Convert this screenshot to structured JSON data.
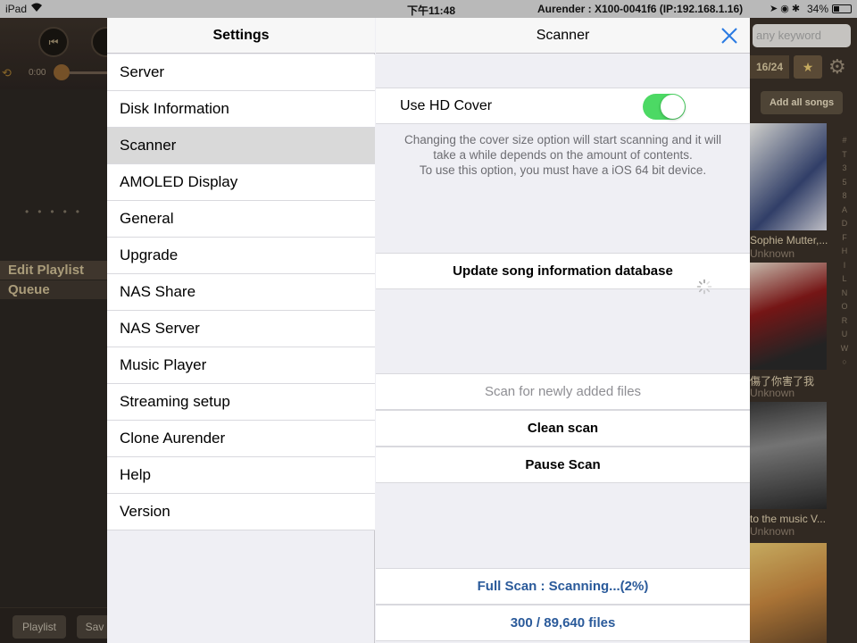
{
  "status_bar": {
    "device": "iPad",
    "time": "下午11:48",
    "title": "Aurender : X100-0041f6 (IP:192.168.1.16)",
    "battery": "34%"
  },
  "background": {
    "playback_time": "0:00",
    "edit_playlist": "Edit Playlist",
    "queue": "Queue",
    "tab_playlist": "Playlist",
    "tab_save": "Sav",
    "search_placeholder": "any keyword",
    "count": "16/24",
    "add_all": "Add all songs",
    "albums": [
      {
        "title": "Sophie Mutter,...",
        "artist": "Unknown"
      },
      {
        "title": "傷了你害了我",
        "artist": "Unknown"
      },
      {
        "title": "to the music V...",
        "artist": "Unknown"
      }
    ],
    "index_letters": [
      "#",
      "T",
      "3",
      "5",
      "8",
      "A",
      "D",
      "F",
      "H",
      "I",
      "L",
      "N",
      "O",
      "R",
      "U",
      "W",
      "○"
    ]
  },
  "settings": {
    "title": "Settings",
    "items": [
      "Server",
      "Disk Information",
      "Scanner",
      "AMOLED Display",
      "General",
      "Upgrade",
      "NAS Share",
      "NAS Server",
      "Music Player",
      "Streaming setup",
      "Clone Aurender",
      "Help",
      "Version"
    ],
    "selected_index": 2
  },
  "scanner": {
    "title": "Scanner",
    "hd_cover_label": "Use HD Cover",
    "hd_cover_enabled": true,
    "note_lines": [
      "Changing the cover size option will start scanning and it will",
      "take a while depends on the amount of contents.",
      "To use this option, you must have a iOS 64 bit device."
    ],
    "update_db": "Update song information database",
    "scan_new": "Scan for newly added files",
    "clean_scan": "Clean scan",
    "pause_scan": "Pause Scan",
    "status": "Full Scan : Scanning...(2%)",
    "files": "300 / 89,640 files",
    "progress_percent": 2
  },
  "colors": {
    "toggle_on": "#4cd964",
    "status_blue": "#2a5a9a",
    "close_blue": "#2a7ae2"
  }
}
